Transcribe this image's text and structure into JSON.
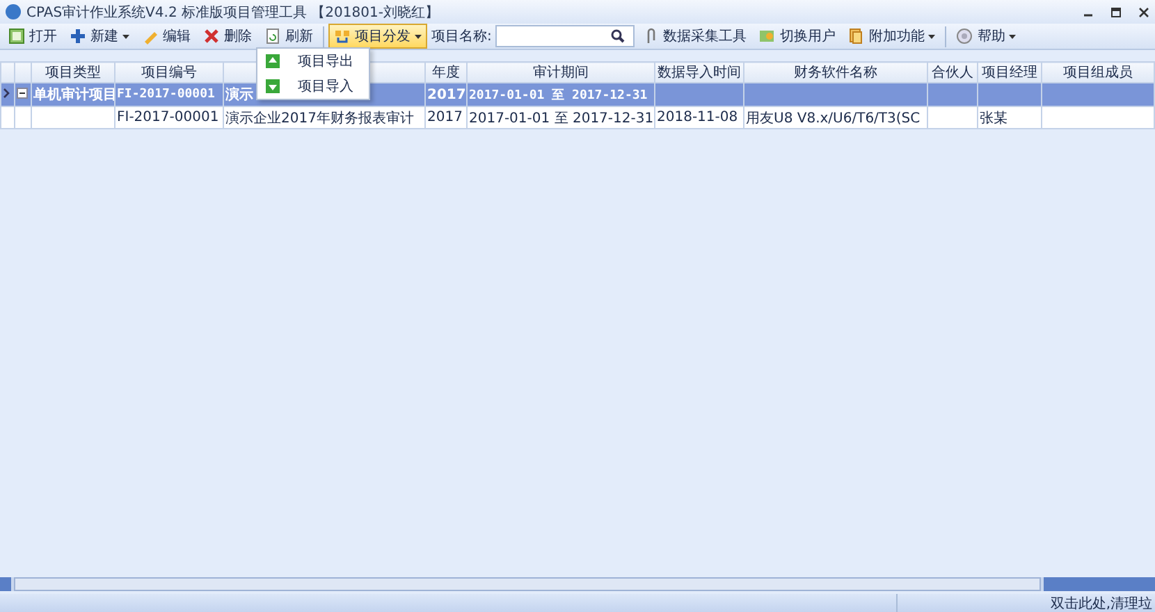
{
  "window": {
    "title": "CPAS审计作业系统V4.2 标准版项目管理工具 【201801-刘晓红】"
  },
  "toolbar": [
    {
      "kind": "button",
      "label": "打开",
      "dropdown": false,
      "selected": false
    },
    {
      "kind": "button",
      "label": "新建",
      "dropdown": true,
      "selected": false
    },
    {
      "kind": "button",
      "label": "编辑",
      "dropdown": false,
      "selected": false
    },
    {
      "kind": "button",
      "label": "删除",
      "dropdown": false,
      "selected": false
    },
    {
      "kind": "button",
      "label": "刷新",
      "dropdown": false,
      "selected": false
    },
    {
      "kind": "separator"
    },
    {
      "kind": "button",
      "label": "项目分发",
      "dropdown": true,
      "selected": true
    },
    {
      "kind": "search",
      "label": "项目名称:"
    },
    {
      "kind": "button",
      "label": "数据采集工具",
      "dropdown": false,
      "selected": false
    },
    {
      "kind": "button",
      "label": "切换用户",
      "dropdown": false,
      "selected": false
    },
    {
      "kind": "button",
      "label": "附加功能",
      "dropdown": true,
      "selected": false
    },
    {
      "kind": "separator"
    },
    {
      "kind": "button",
      "label": "帮助",
      "dropdown": true,
      "selected": false
    }
  ],
  "menu": [
    {
      "label": "项目导出"
    },
    {
      "label": "项目导入"
    }
  ],
  "table": {
    "columns": [
      "项目类型",
      "项目编号",
      null,
      "年度",
      "审计期间",
      "数据导入时间",
      "财务软件名称",
      "合伙人",
      "项目经理",
      "项目组成员"
    ],
    "rows": [
      {
        "kind": "group",
        "selected": true,
        "expanded": true,
        "cells": [
          "单机审计项目",
          "FI-2017-00001",
          "演示",
          "2017",
          "2017-01-01 至 2017-12-31",
          "",
          "",
          "",
          "",
          ""
        ]
      },
      {
        "kind": "item",
        "selected": false,
        "cells": [
          "",
          "FI-2017-00001",
          "演示企业2017年财务报表审计",
          "2017",
          "2017-01-01 至 2017-12-31",
          "2018-11-08",
          "用友U8 V8.x/U6/T6/T3(SC",
          "",
          "张某",
          ""
        ]
      }
    ]
  },
  "status_bar": {
    "text": "双击此处,清理垃"
  }
}
